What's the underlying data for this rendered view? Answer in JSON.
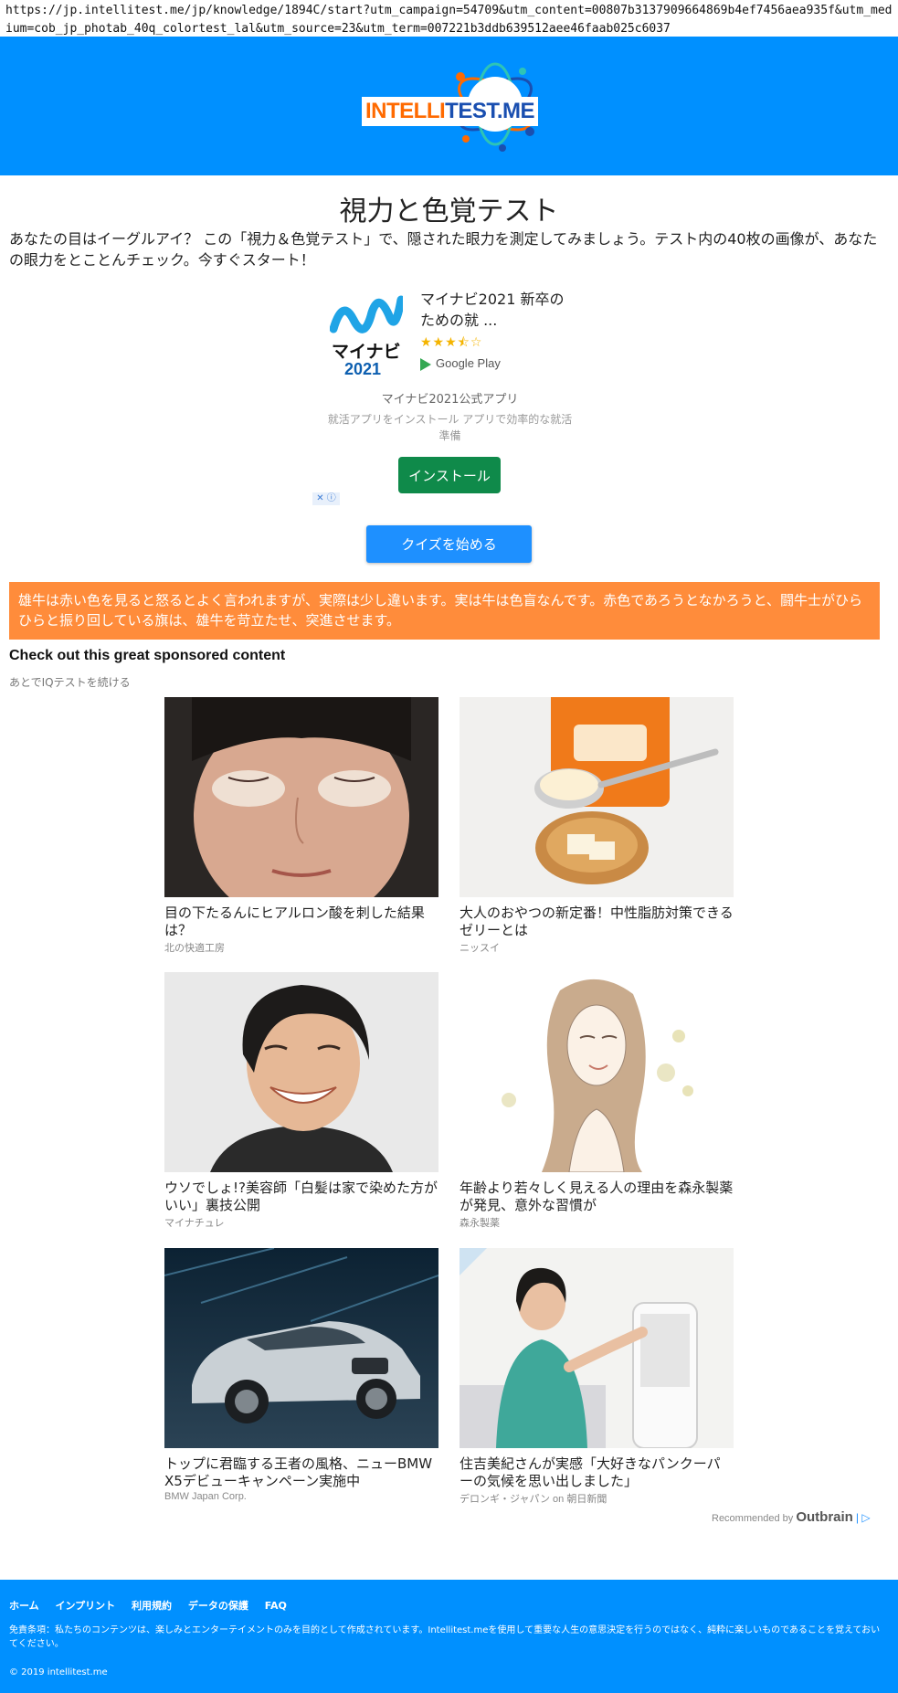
{
  "browser": {
    "url": "https://jp.intellitest.me/jp/knowledge/1894C/start?utm_campaign=54709&utm_content=00807b3137909664869b4ef7456aea935f&utm_medium=cob_jp_photab_40q_colortest_lal&utm_source=23&utm_term=007221b3ddb639512aee46faab025c6037"
  },
  "header": {
    "logo_part1": "INTELLI",
    "logo_part2": "TEST.ME"
  },
  "page": {
    "title": "視力と色覚テスト",
    "intro": "あなたの目はイーグルアイ？ この「視力＆色覚テスト」で、隠された眼力を測定してみましょう。テスト内の40枚の画像が、あなたの眼力をとことんチェック。今すぐスタート！"
  },
  "ad": {
    "icon_name": "マイナビ",
    "icon_year": "2021",
    "title": "マイナビ2021 新卒のための就 ...",
    "rating": 3.5,
    "stars": "★★★⯪☆",
    "store": "Google Play",
    "subtitle": "マイナビ2021公式アプリ",
    "description": "就活アプリをインストール アプリで効率的な就活準備",
    "install_label": "インストール",
    "adchoices": "✕ ⓘ"
  },
  "quiz": {
    "start_label": "クイズを始める"
  },
  "fact": {
    "text": "雄牛は赤い色を見ると怒るとよく言われますが、実際は少し違います。実は牛は色盲なんです。赤色であろうとなかろうと、闘牛士がひらひらと振り回している旗は、雄牛を苛立たせ、突進させます。"
  },
  "sponsored": {
    "heading": "Check out this great sponsored content",
    "later": "あとでIQテストを続ける",
    "cards": [
      {
        "title": "目の下たるんにヒアルロン酸を刺した結果は？",
        "source": "北の快適工房"
      },
      {
        "title": "大人のおやつの新定番！中性脂肪対策できるゼリーとは",
        "source": "ニッスイ"
      },
      {
        "title": "ウソでしょ!?美容師「白髪は家で染めた方がいい」裏技公開",
        "source": "マイナチュレ"
      },
      {
        "title": "年齢より若々しく見える人の理由を森永製薬が発見、意外な習慣が",
        "source": "森永製薬"
      },
      {
        "title": "トップに君臨する王者の風格、ニューBMW X5デビューキャンペーン実施中",
        "source": "BMW Japan Corp."
      },
      {
        "title": "住吉美紀さんが実感「大好きなパンクーパーの気候を思い出しました」",
        "source": "デロンギ・ジャパン on 朝日新聞"
      }
    ],
    "recommended_by": "Recommended by",
    "outbrain": "Outbrain"
  },
  "footer": {
    "nav": [
      "ホーム",
      "インプリント",
      "利用規約",
      "データの保護",
      "FAQ"
    ],
    "disclaimer": "免責条項：私たちのコンテンツは、楽しみとエンターテイメントのみを目的として作成されています。Intellitest.meを使用して重要な人生の意思決定を行うのではなく、純粋に楽しいものであることを覚えておいてください。",
    "copyright": "© 2019 intellitest.me"
  },
  "colors": {
    "brand_blue": "#0090ff",
    "fact_orange": "#ff8c3b",
    "install_green": "#0f8a4a",
    "quiz_blue": "#1e90ff"
  }
}
